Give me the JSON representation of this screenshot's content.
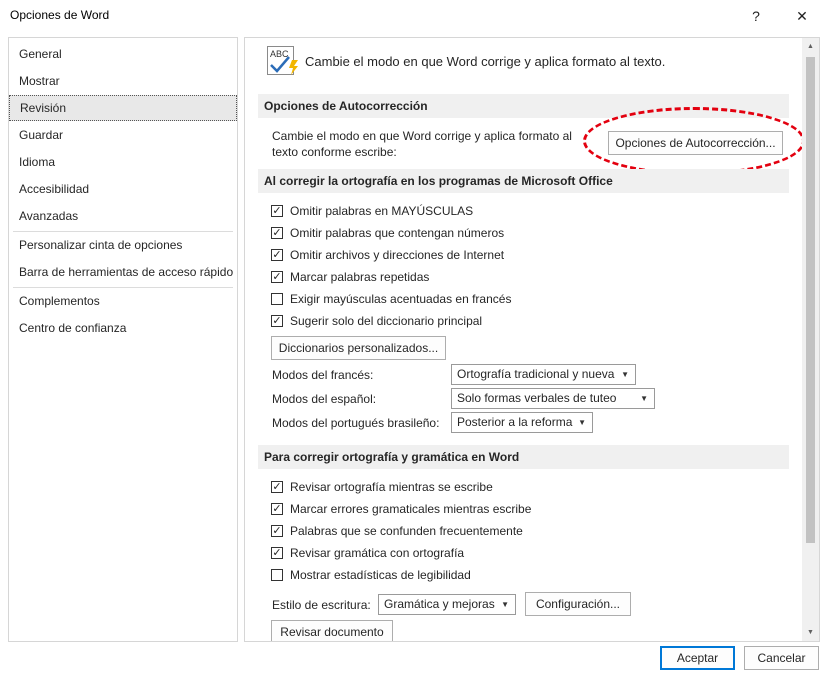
{
  "window": {
    "title": "Opciones de Word",
    "help_glyph": "?",
    "close_glyph": "✕"
  },
  "sidebar": {
    "items": [
      {
        "label": "General"
      },
      {
        "label": "Mostrar"
      },
      {
        "label": "Revisión",
        "selected": true
      },
      {
        "label": "Guardar"
      },
      {
        "label": "Idioma"
      },
      {
        "label": "Accesibilidad"
      },
      {
        "label": "Avanzadas"
      },
      {
        "label": "Personalizar cinta de opciones"
      },
      {
        "label": "Barra de herramientas de acceso rápido"
      },
      {
        "label": "Complementos"
      },
      {
        "label": "Centro de confianza"
      }
    ]
  },
  "content": {
    "header": {
      "icon": "abc-check-icon",
      "icon_text": "ABC",
      "text": "Cambie el modo en que Word corrige y aplica formato al texto."
    },
    "autocorrect": {
      "title": "Opciones de Autocorrección",
      "description": "Cambie el modo en que Word corrige y aplica formato al texto conforme escribe:",
      "button": "Opciones de Autocorrección..."
    },
    "office_spelling": {
      "title": "Al corregir la ortografía en los programas de Microsoft Office",
      "checks": [
        {
          "label": "Omitir palabras en MAYÚSCULAS",
          "checked": true
        },
        {
          "label": "Omitir palabras que contengan números",
          "checked": true
        },
        {
          "label": "Omitir archivos y direcciones de Internet",
          "checked": true
        },
        {
          "label": "Marcar palabras repetidas",
          "checked": true
        },
        {
          "label": "Exigir mayúsculas acentuadas en francés",
          "checked": false
        },
        {
          "label": "Sugerir solo del diccionario principal",
          "checked": true
        }
      ],
      "dictionaries_button": "Diccionarios personalizados...",
      "french_label": "Modos del francés:",
      "french_value": "Ortografía tradicional y nueva",
      "spanish_label": "Modos del español:",
      "spanish_value": "Solo formas verbales de tuteo",
      "portuguese_label": "Modos del portugués brasileño:",
      "portuguese_value": "Posterior a la reforma"
    },
    "word_spelling": {
      "title": "Para corregir ortografía y gramática en Word",
      "checks": [
        {
          "label": "Revisar ortografía mientras se escribe",
          "checked": true
        },
        {
          "label": "Marcar errores gramaticales mientras escribe",
          "checked": true
        },
        {
          "label": "Palabras que se confunden frecuentemente",
          "checked": true
        },
        {
          "label": "Revisar gramática con ortografía",
          "checked": true
        },
        {
          "label": "Mostrar estadísticas de legibilidad",
          "checked": false
        }
      ],
      "style_label": "Estilo de escritura:",
      "style_value": "Gramática y mejoras",
      "settings_button": "Configuración...",
      "check_document_button": "Revisar documento"
    }
  },
  "footer": {
    "ok": "Aceptar",
    "cancel": "Cancelar"
  },
  "colors": {
    "annotation": "#e3000f",
    "accent": "#0078d7"
  }
}
